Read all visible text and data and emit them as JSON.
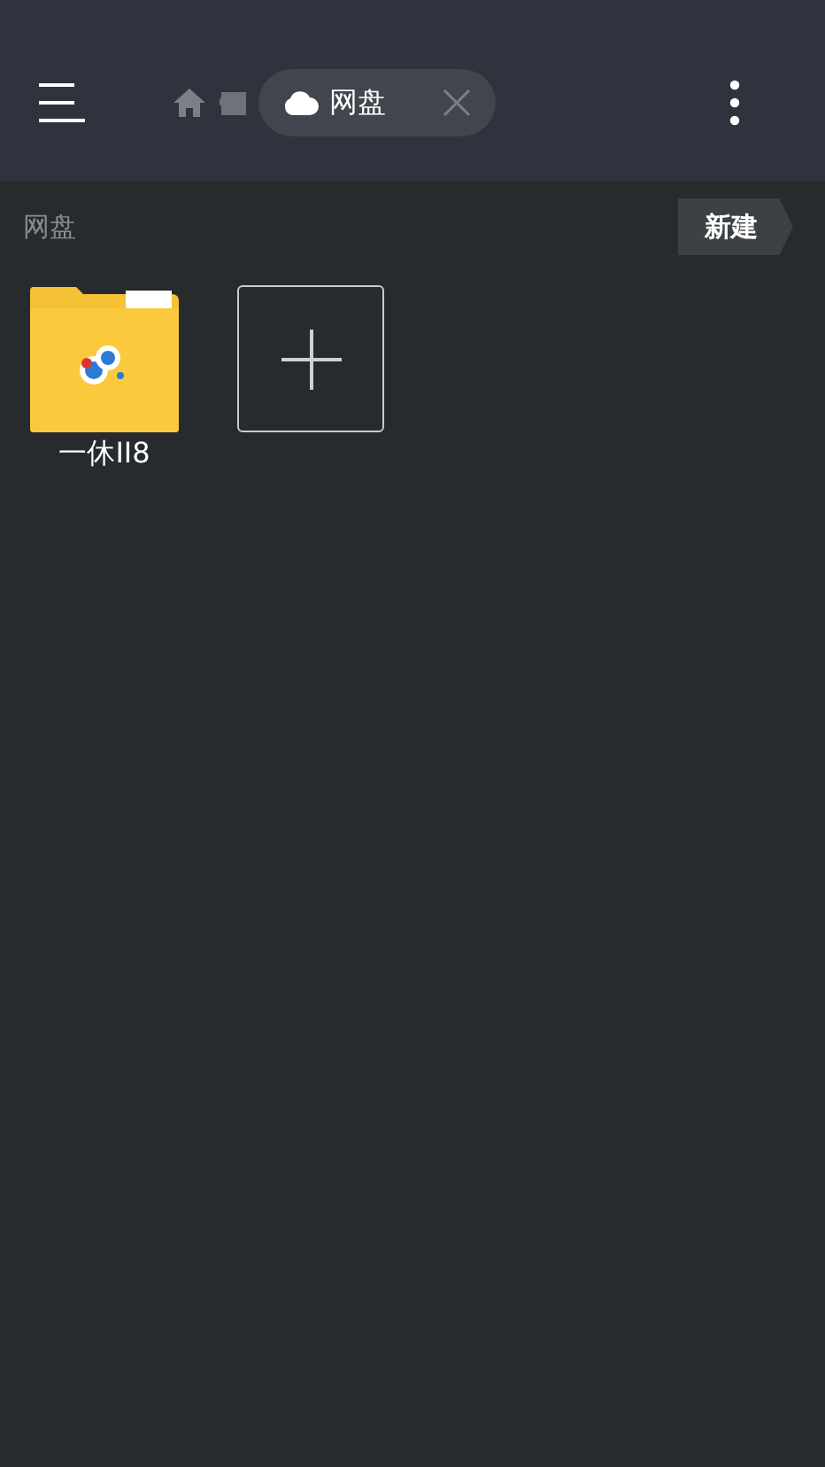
{
  "toolbar": {
    "tab": {
      "label": "网盘"
    }
  },
  "path_label": "网盘",
  "new_button": "新建",
  "items": [
    {
      "kind": "folder",
      "name": "一休II8"
    },
    {
      "kind": "add"
    }
  ]
}
